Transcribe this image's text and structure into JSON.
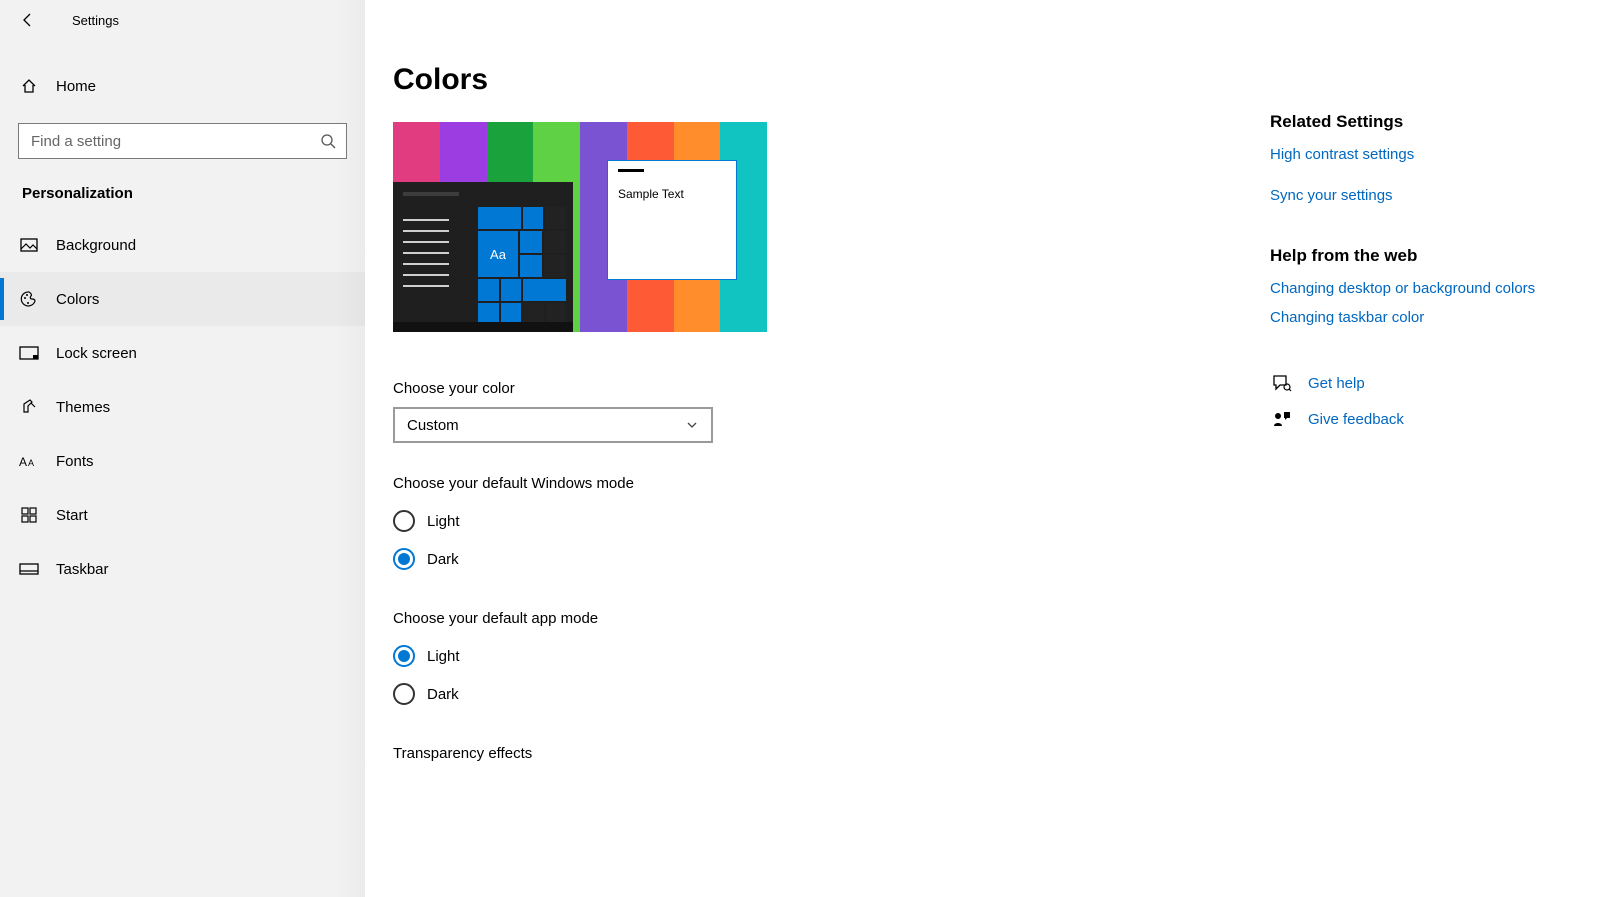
{
  "app_title": "Settings",
  "home_label": "Home",
  "search_placeholder": "Find a setting",
  "section_label": "Personalization",
  "nav": {
    "items": [
      {
        "label": "Background"
      },
      {
        "label": "Colors"
      },
      {
        "label": "Lock screen"
      },
      {
        "label": "Themes"
      },
      {
        "label": "Fonts"
      },
      {
        "label": "Start"
      },
      {
        "label": "Taskbar"
      }
    ],
    "selected_index": 1
  },
  "page": {
    "title": "Colors",
    "preview_sample_text": "Sample Text",
    "preview_tile_text": "Aa",
    "choose_color_label": "Choose your color",
    "choose_color_value": "Custom",
    "windows_mode_label": "Choose your default Windows mode",
    "windows_mode_options": [
      {
        "label": "Light",
        "checked": false
      },
      {
        "label": "Dark",
        "checked": true
      }
    ],
    "app_mode_label": "Choose your default app mode",
    "app_mode_options": [
      {
        "label": "Light",
        "checked": true
      },
      {
        "label": "Dark",
        "checked": false
      }
    ],
    "transparency_label": "Transparency effects"
  },
  "rail": {
    "related_heading": "Related Settings",
    "related_links": [
      "High contrast settings",
      "Sync your settings"
    ],
    "help_heading": "Help from the web",
    "help_links": [
      "Changing desktop or background colors",
      "Changing taskbar color"
    ],
    "get_help": "Get help",
    "give_feedback": "Give feedback"
  }
}
